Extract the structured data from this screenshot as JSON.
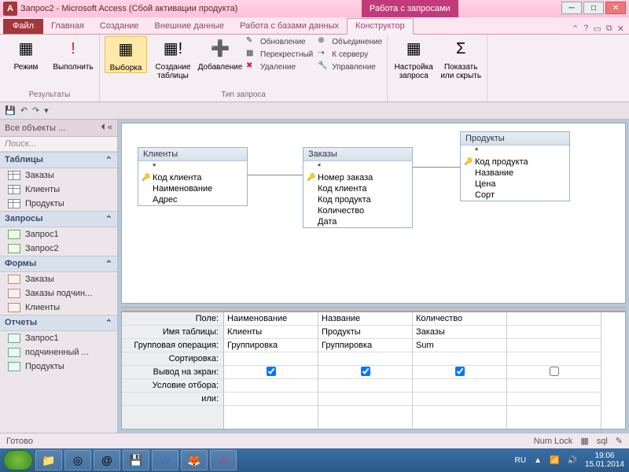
{
  "title": "Запрос2 - Microsoft Access (Сбой активации продукта)",
  "toolTab": "Работа с запросами",
  "tabs": {
    "file": "Файл",
    "home": "Главная",
    "create": "Создание",
    "external": "Внешние данные",
    "db": "Работа с базами данных",
    "design": "Конструктор"
  },
  "ribbon": {
    "results": {
      "mode": "Режим",
      "run": "Выполнить",
      "label": "Результаты"
    },
    "qtype": {
      "select": "Выборка",
      "maketbl": "Создание\nтаблицы",
      "append": "Добавление",
      "update": "Обновление",
      "crosstab": "Перекрестный",
      "delete": "Удаление",
      "union": "Объединение",
      "passthrough": "К серверу",
      "datadef": "Управление",
      "label": "Тип запроса"
    },
    "setup": {
      "setup": "Настройка\nзапроса",
      "showhide": "Показать\nили скрыть"
    }
  },
  "nav": {
    "header": "Все объекты ...",
    "search": "Поиск...",
    "cats": {
      "tables": "Таблицы",
      "queries": "Запросы",
      "forms": "Формы",
      "reports": "Отчеты"
    },
    "tables": [
      "Заказы",
      "Клиенты",
      "Продукты"
    ],
    "queries": [
      "Запрос1",
      "Запрос2"
    ],
    "forms": [
      "Заказы",
      "Заказы подчин...",
      "Клиенты"
    ],
    "reports": [
      "Запрос1",
      "подчиненный ...",
      "Продукты"
    ]
  },
  "diagram": {
    "t1": {
      "name": "Клиенты",
      "star": "*",
      "f": [
        "Код клиента",
        "Наименование",
        "Адрес"
      ],
      "key": 0
    },
    "t2": {
      "name": "Заказы",
      "star": "*",
      "f": [
        "Номер заказа",
        "Код клиента",
        "Код продукта",
        "Количество",
        "Дата"
      ],
      "key": 0
    },
    "t3": {
      "name": "Продукты",
      "star": "*",
      "f": [
        "Код продукта",
        "Название",
        "Цена",
        "Сорт"
      ],
      "key": 0
    }
  },
  "grid": {
    "rows": [
      "Поле:",
      "Имя таблицы:",
      "Групповая операция:",
      "Сортировка:",
      "Вывод на экран:",
      "Условие отбора:",
      "или:"
    ],
    "cols": [
      {
        "field": "Наименование",
        "table": "Клиенты",
        "group": "Группировка",
        "show": true
      },
      {
        "field": "Название",
        "table": "Продукты",
        "group": "Группировка",
        "show": true
      },
      {
        "field": "Количество",
        "table": "Заказы",
        "group": "Sum",
        "show": true
      },
      {
        "field": "",
        "table": "",
        "group": "",
        "show": false
      }
    ]
  },
  "status": {
    "ready": "Готово",
    "numlock": "Num Lock"
  },
  "taskbar": {
    "lang": "RU",
    "time": "19:06",
    "date": "15.01.2014"
  }
}
